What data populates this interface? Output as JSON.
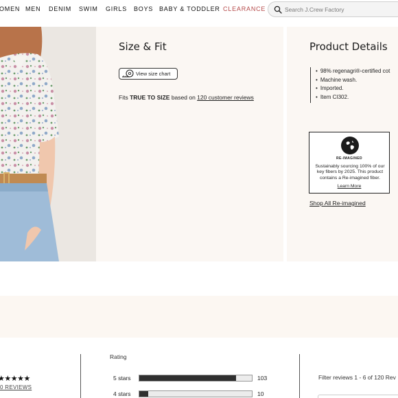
{
  "nav": {
    "items": [
      "OMEN",
      "MEN",
      "DENIM",
      "SWIM",
      "GIRLS",
      "BOYS",
      "BABY & TODDLER",
      "CLEARANCE"
    ],
    "accent_color": "#b54a4a"
  },
  "search": {
    "placeholder": "Search J.Crew Factory",
    "icon": "search-icon"
  },
  "size_fit": {
    "title": "Size & Fit",
    "size_chart_label": "View size chart",
    "fits_prefix": "Fits ",
    "fits_emphasis": "TRUE TO SIZE",
    "fits_middle": " based on ",
    "fits_link": "120 customer reviews"
  },
  "product_details": {
    "title": "Product Details",
    "bullets": [
      "98% regenagri®-certified cot",
      "Machine wash.",
      "Imported.",
      "Item CI302."
    ],
    "reimagined_label": "RE-IMAGINED",
    "reimagined_text": "Sustainably sourcing 100% of our key fibers by 2025. This product contains a Re-imagined fiber.",
    "learn_more": "Learn More",
    "shop_all": "Shop All Re-imagined"
  },
  "reviews": {
    "stars": "★★★★★",
    "all_reviews_link": "0 REVIEWS",
    "rating_heading": "Rating",
    "breakdown": [
      {
        "label": "5 stars",
        "count": "103",
        "fraction": 0.86
      },
      {
        "label": "4 stars",
        "count": "10",
        "fraction": 0.08
      }
    ],
    "filter_text": "Filter reviews 1 - 6 of 120 Rev"
  }
}
